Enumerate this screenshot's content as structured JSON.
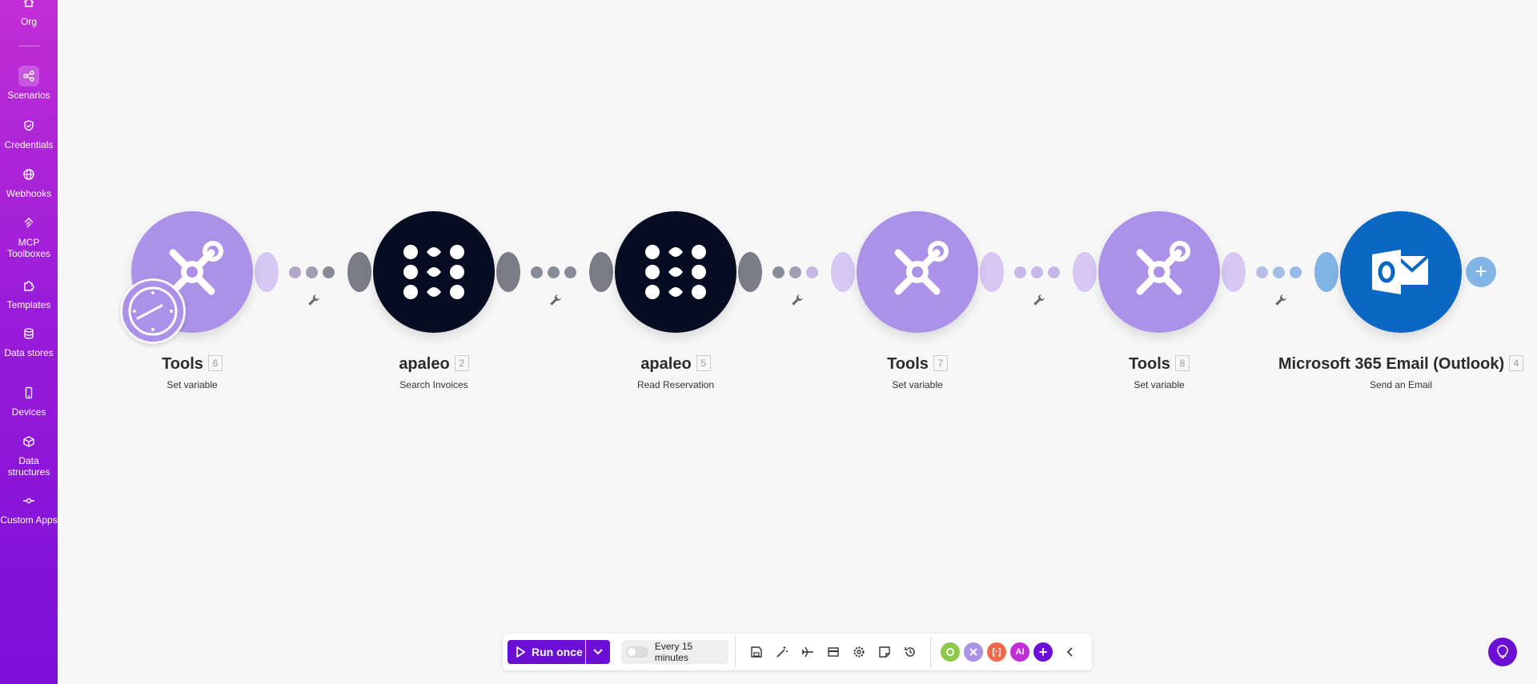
{
  "sidebar": {
    "items": [
      {
        "label": "Org",
        "icon": "home-icon"
      },
      {
        "label": "Scenarios",
        "icon": "share-icon",
        "active": true
      },
      {
        "label": "Credentials",
        "icon": "shield-check-icon"
      },
      {
        "label": "Webhooks",
        "icon": "globe-icon"
      },
      {
        "label": "MCP Toolboxes",
        "icon": "mcp-icon"
      },
      {
        "label": "Templates",
        "icon": "puzzle-icon"
      },
      {
        "label": "Data stores",
        "icon": "database-icon"
      },
      {
        "label": "Devices",
        "icon": "device-icon"
      },
      {
        "label": "Data structures",
        "icon": "cube-icon"
      },
      {
        "label": "Custom Apps",
        "icon": "commit-icon"
      }
    ],
    "gradient": [
      "#c12ed6",
      "#7b0fd9"
    ]
  },
  "scenario": {
    "modules": [
      {
        "app": "Tools",
        "id": "6",
        "action": "Set variable",
        "color": "#ab91e8"
      },
      {
        "app": "apaleo",
        "id": "2",
        "action": "Search Invoices",
        "color": "#060c22"
      },
      {
        "app": "apaleo",
        "id": "5",
        "action": "Read Reservation",
        "color": "#060c22"
      },
      {
        "app": "Tools",
        "id": "7",
        "action": "Set variable",
        "color": "#ab91e8"
      },
      {
        "app": "Tools",
        "id": "8",
        "action": "Set variable",
        "color": "#ab91e8"
      },
      {
        "app": "Microsoft 365 Email (Outlook)",
        "id": "4",
        "action": "Send an Email",
        "color": "#0a67c4"
      }
    ]
  },
  "toolbar": {
    "run_label": "Run once",
    "schedule_label": "Every 15 minutes",
    "accent": "#6b0fd6",
    "icons": [
      "save-icon",
      "magic-wand-icon",
      "airplane-icon",
      "layout-icon",
      "gear-icon",
      "note-icon",
      "history-icon"
    ],
    "apps": [
      {
        "label": "",
        "color": "#8cc84b",
        "icon": "gear-app-icon"
      },
      {
        "label": "",
        "color": "#ab91e8",
        "icon": "tools-app-icon"
      },
      {
        "label": "[·]",
        "color": "#f06a4b"
      },
      {
        "label": "AI",
        "color": "#c12ed6"
      }
    ]
  }
}
